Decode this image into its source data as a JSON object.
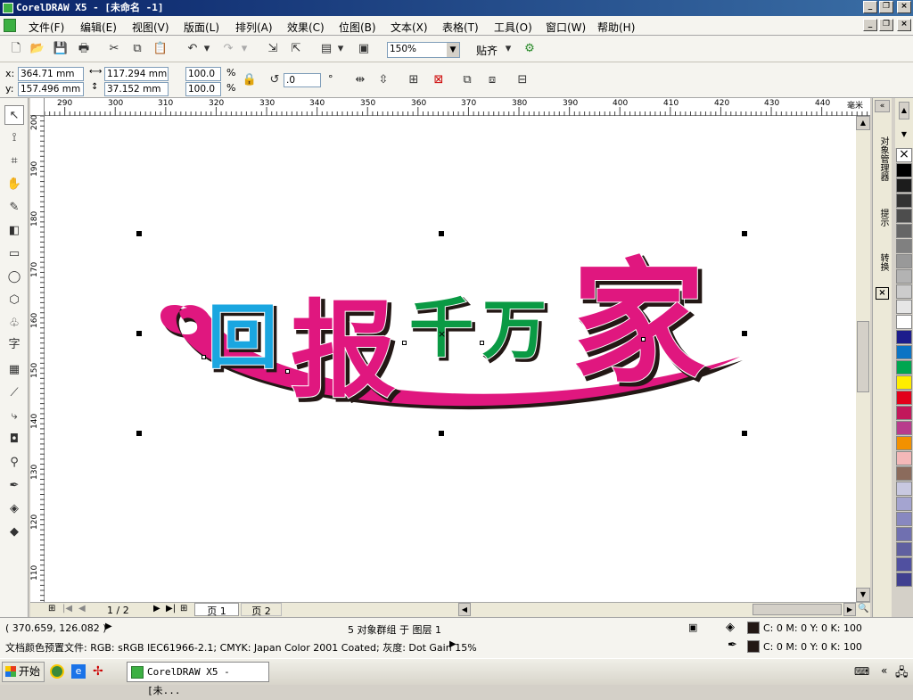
{
  "window": {
    "title": "CorelDRAW X5 - [未命名 -1]"
  },
  "menu": [
    "文件(F)",
    "编辑(E)",
    "视图(V)",
    "版面(L)",
    "排列(A)",
    "效果(C)",
    "位图(B)",
    "文本(X)",
    "表格(T)",
    "工具(O)",
    "窗口(W)",
    "帮助(H)"
  ],
  "toolbar": {
    "zoom": "150%",
    "snap_label": "贴齐"
  },
  "props": {
    "x": "364.71 mm",
    "y": "157.496 mm",
    "w": "117.294 mm",
    "h": "37.152 mm",
    "sx": "100.0",
    "sy": "100.0",
    "pct": "%",
    "angle": ".0",
    "deg": "°"
  },
  "ruler": {
    "h_ticks": [
      "290",
      "300",
      "310",
      "320",
      "330",
      "340",
      "350",
      "360",
      "370",
      "380",
      "390",
      "400",
      "410",
      "420",
      "430",
      "440"
    ],
    "h_unit": "毫米",
    "v_ticks": [
      "200",
      "190",
      "180",
      "170",
      "160",
      "150",
      "140",
      "130",
      "120",
      "110"
    ]
  },
  "artwork": {
    "chars": [
      "回",
      "报",
      "千",
      "万",
      "家"
    ],
    "colors": {
      "cyan": "#1aa6e0",
      "magenta": "#e0177f",
      "green": "#0a9a44"
    }
  },
  "pages": {
    "counter": "1 / 2",
    "tab1": "页 1",
    "tab2": "页 2"
  },
  "docker": {
    "tab1": "对象管理器",
    "tab2": "提示",
    "tab3": "转换"
  },
  "palette": [
    "#ffffff",
    "#000000",
    "#1c1c1c",
    "#333333",
    "#4d4d4d",
    "#666666",
    "#808080",
    "#999999",
    "#b3b3b3",
    "#cccccc",
    "#e6e6e6",
    "#ffffff",
    "#1d1d8c",
    "#0b74c4",
    "#00a650",
    "#ffed00",
    "#e2001a",
    "#c2185b",
    "#b83b8c",
    "#f29100",
    "#f4b8b8",
    "#8b6b5c",
    "#c8c8e0",
    "#a4a4d0",
    "#8888c0",
    "#7070b0",
    "#6060a0",
    "#5050a0",
    "#404090"
  ],
  "status": {
    "coords": "( 370.659, 126.082 )",
    "selection": "5 对象群组 于 图层 1",
    "profile": "文档颜色预置文件: RGB: sRGB IEC61966-2.1; CMYK: Japan Color 2001 Coated; 灰度: Dot Gain 15%",
    "fill": "C: 0 M: 0 Y: 0 K: 100",
    "outline": "C: 0 M: 0 Y: 0 K: 100"
  },
  "taskbar": {
    "start": "开始",
    "task": "CorelDRAW X5 - [未..."
  }
}
